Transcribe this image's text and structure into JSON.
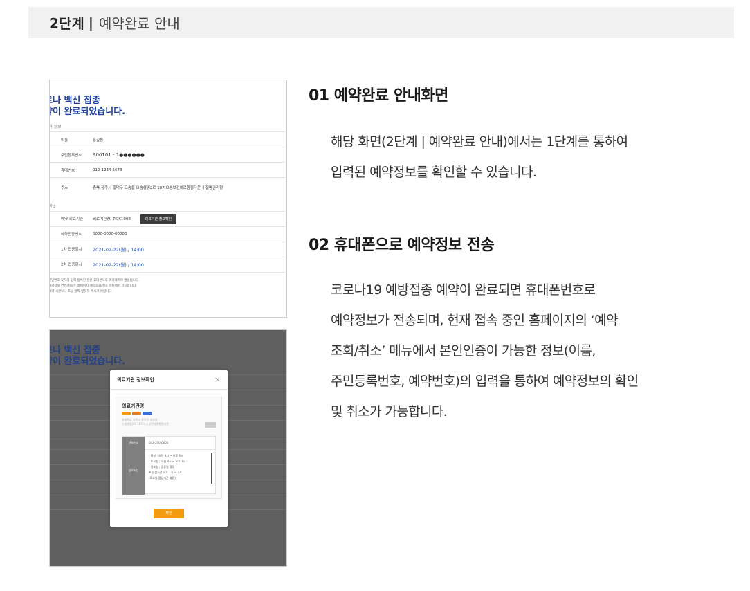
{
  "header": {
    "step": "2단계",
    "separator": "|",
    "title": "예약완료 안내"
  },
  "screenshot1": {
    "title_line1": "로나 백신 접종",
    "title_line2": "약이 완료되었습니다.",
    "section1": "자 정보",
    "rows": [
      {
        "label": "이름",
        "value": "홍길동"
      },
      {
        "label": "주민등록번호",
        "value": "900101 - 1●●●●●●"
      },
      {
        "label": "휴대번호",
        "value": "010-1234-5678"
      },
      {
        "label": "주소",
        "value": "충북 청주시 흥덕구 오송읍 오송생명2로 187 오송보건의료행정타운내 질병관리청"
      }
    ],
    "section2": "정보",
    "rows2": [
      {
        "label": "예약 의료기관",
        "value": "의료기관명, 7K-K1008",
        "button": "의료기관 정보확인"
      },
      {
        "label": "예약접종번호",
        "value": "0000-0000-00000"
      },
      {
        "label": "1차 접종일시",
        "value": "2021-02-22(월) / 14:00"
      },
      {
        "label": "2차 접종일시",
        "value": "2021-02-22(월) / 14:00"
      }
    ],
    "note_line1": "주민번호 뒷자리 입력 등록된 본인 휴대폰으로 예약내역이 발송됩니다.",
    "note_line2": "예약정보 변경/취소는 홈페이지 예약조회/취소 메뉴에서 가능합니다.",
    "note_line3": "예약 시간보다 조금 일찍 방문해 주시기 바랍니다."
  },
  "screenshot2": {
    "title_line1": "로나 백신 접종",
    "title_line2": "약이 완료되었습니다.",
    "modal_title": "의료기관 정보확인",
    "close": "×",
    "clinic_name": "의료기관명",
    "tag_colors": [
      "#f39c12",
      "#e67e22",
      "#3b6fd0"
    ],
    "address_line1": "충청북도 청주시 흥덕구 오송읍",
    "address_line2": "오송생명2로 187 오송보건의료행정타운",
    "phone_label": "전화번호",
    "phone_value": "043-200-0000",
    "hours_label": "진료시간",
    "hours": [
      "- 평일 : 오전 9시 ~ 오후 6시",
      "- 토요일 : 오전 9시 ~ 오후 1시",
      "- 일요일 : 공휴일 휴무",
      "※ 점심시간 오후 1시 ~ 2시",
      "(토요일 점심시간 없음)"
    ],
    "ok": "확인"
  },
  "sections": [
    {
      "title": "01 예약완료 안내화면",
      "lines": [
        "해당 화면(2단계 | 예약완료 안내)에서는 1단계를 통하여",
        "입력된 예약정보를 확인할 수 있습니다."
      ]
    },
    {
      "title": "02 휴대폰으로 예약정보 전송",
      "lines": [
        "코로나19 예방접종 예약이 완료되면 휴대폰번호로",
        "예약정보가 전송되며, 현재 접속 중인 홈페이지의 ‘예약",
        "조회/취소’ 메뉴에서 본인인증이 가능한 정보(이름,",
        "주민등록번호, 예약번호)의 입력을 통하여 예약정보의 확인",
        "및 취소가 가능합니다."
      ]
    }
  ]
}
